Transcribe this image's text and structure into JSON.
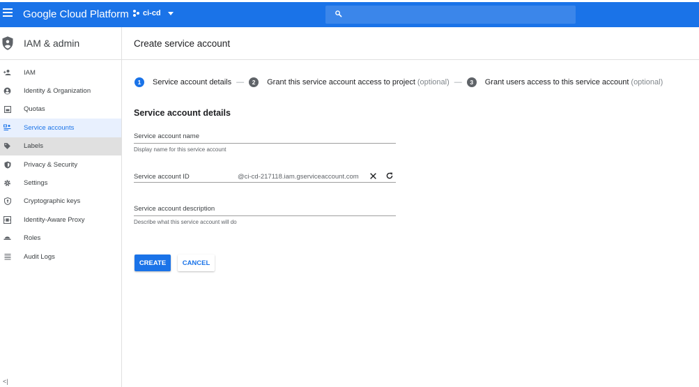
{
  "topbar": {
    "brand": "Google Cloud Platform",
    "project": "ci-cd",
    "icons": [
      "menu-icon",
      "project-icon",
      "chevron-down-icon",
      "search-icon"
    ],
    "accent": "#1a73e8"
  },
  "sidebar": {
    "title": "IAM & admin",
    "items": [
      {
        "label": "IAM",
        "icon": "add-person-icon"
      },
      {
        "label": "Identity & Organization",
        "icon": "account-circle-icon"
      },
      {
        "label": "Quotas",
        "icon": "quota-icon"
      },
      {
        "label": "Service accounts",
        "icon": "service-account-icon"
      },
      {
        "label": "Labels",
        "icon": "label-icon"
      },
      {
        "label": "Privacy & Security",
        "icon": "privacy-icon"
      },
      {
        "label": "Settings",
        "icon": "gear-icon"
      },
      {
        "label": "Cryptographic keys",
        "icon": "key-shield-icon"
      },
      {
        "label": "Identity-Aware Proxy",
        "icon": "proxy-icon"
      },
      {
        "label": "Roles",
        "icon": "roles-icon"
      },
      {
        "label": "Audit Logs",
        "icon": "list-icon"
      }
    ],
    "active_item": "Service accounts",
    "collapse_glyph": "<|"
  },
  "main": {
    "page_title": "Create service account",
    "steps": [
      {
        "num": "1",
        "label": "Service account details",
        "optional": ""
      },
      {
        "num": "2",
        "label": "Grant this service account access to project",
        "optional": "(optional)"
      },
      {
        "num": "3",
        "label": "Grant users access to this service account",
        "optional": "(optional)"
      }
    ],
    "step_separator": "—",
    "section_title": "Service account details",
    "name_field": {
      "label": "Service account name",
      "value": "",
      "hint": "Display name for this service account"
    },
    "id_field": {
      "label": "Service account ID",
      "suffix": "@ci-cd-217118.iam.gserviceaccount.com"
    },
    "description_field": {
      "label": "Service account description",
      "value": "",
      "hint": "Describe what this service account will do"
    },
    "create_label": "CREATE",
    "cancel_label": "CANCEL"
  }
}
